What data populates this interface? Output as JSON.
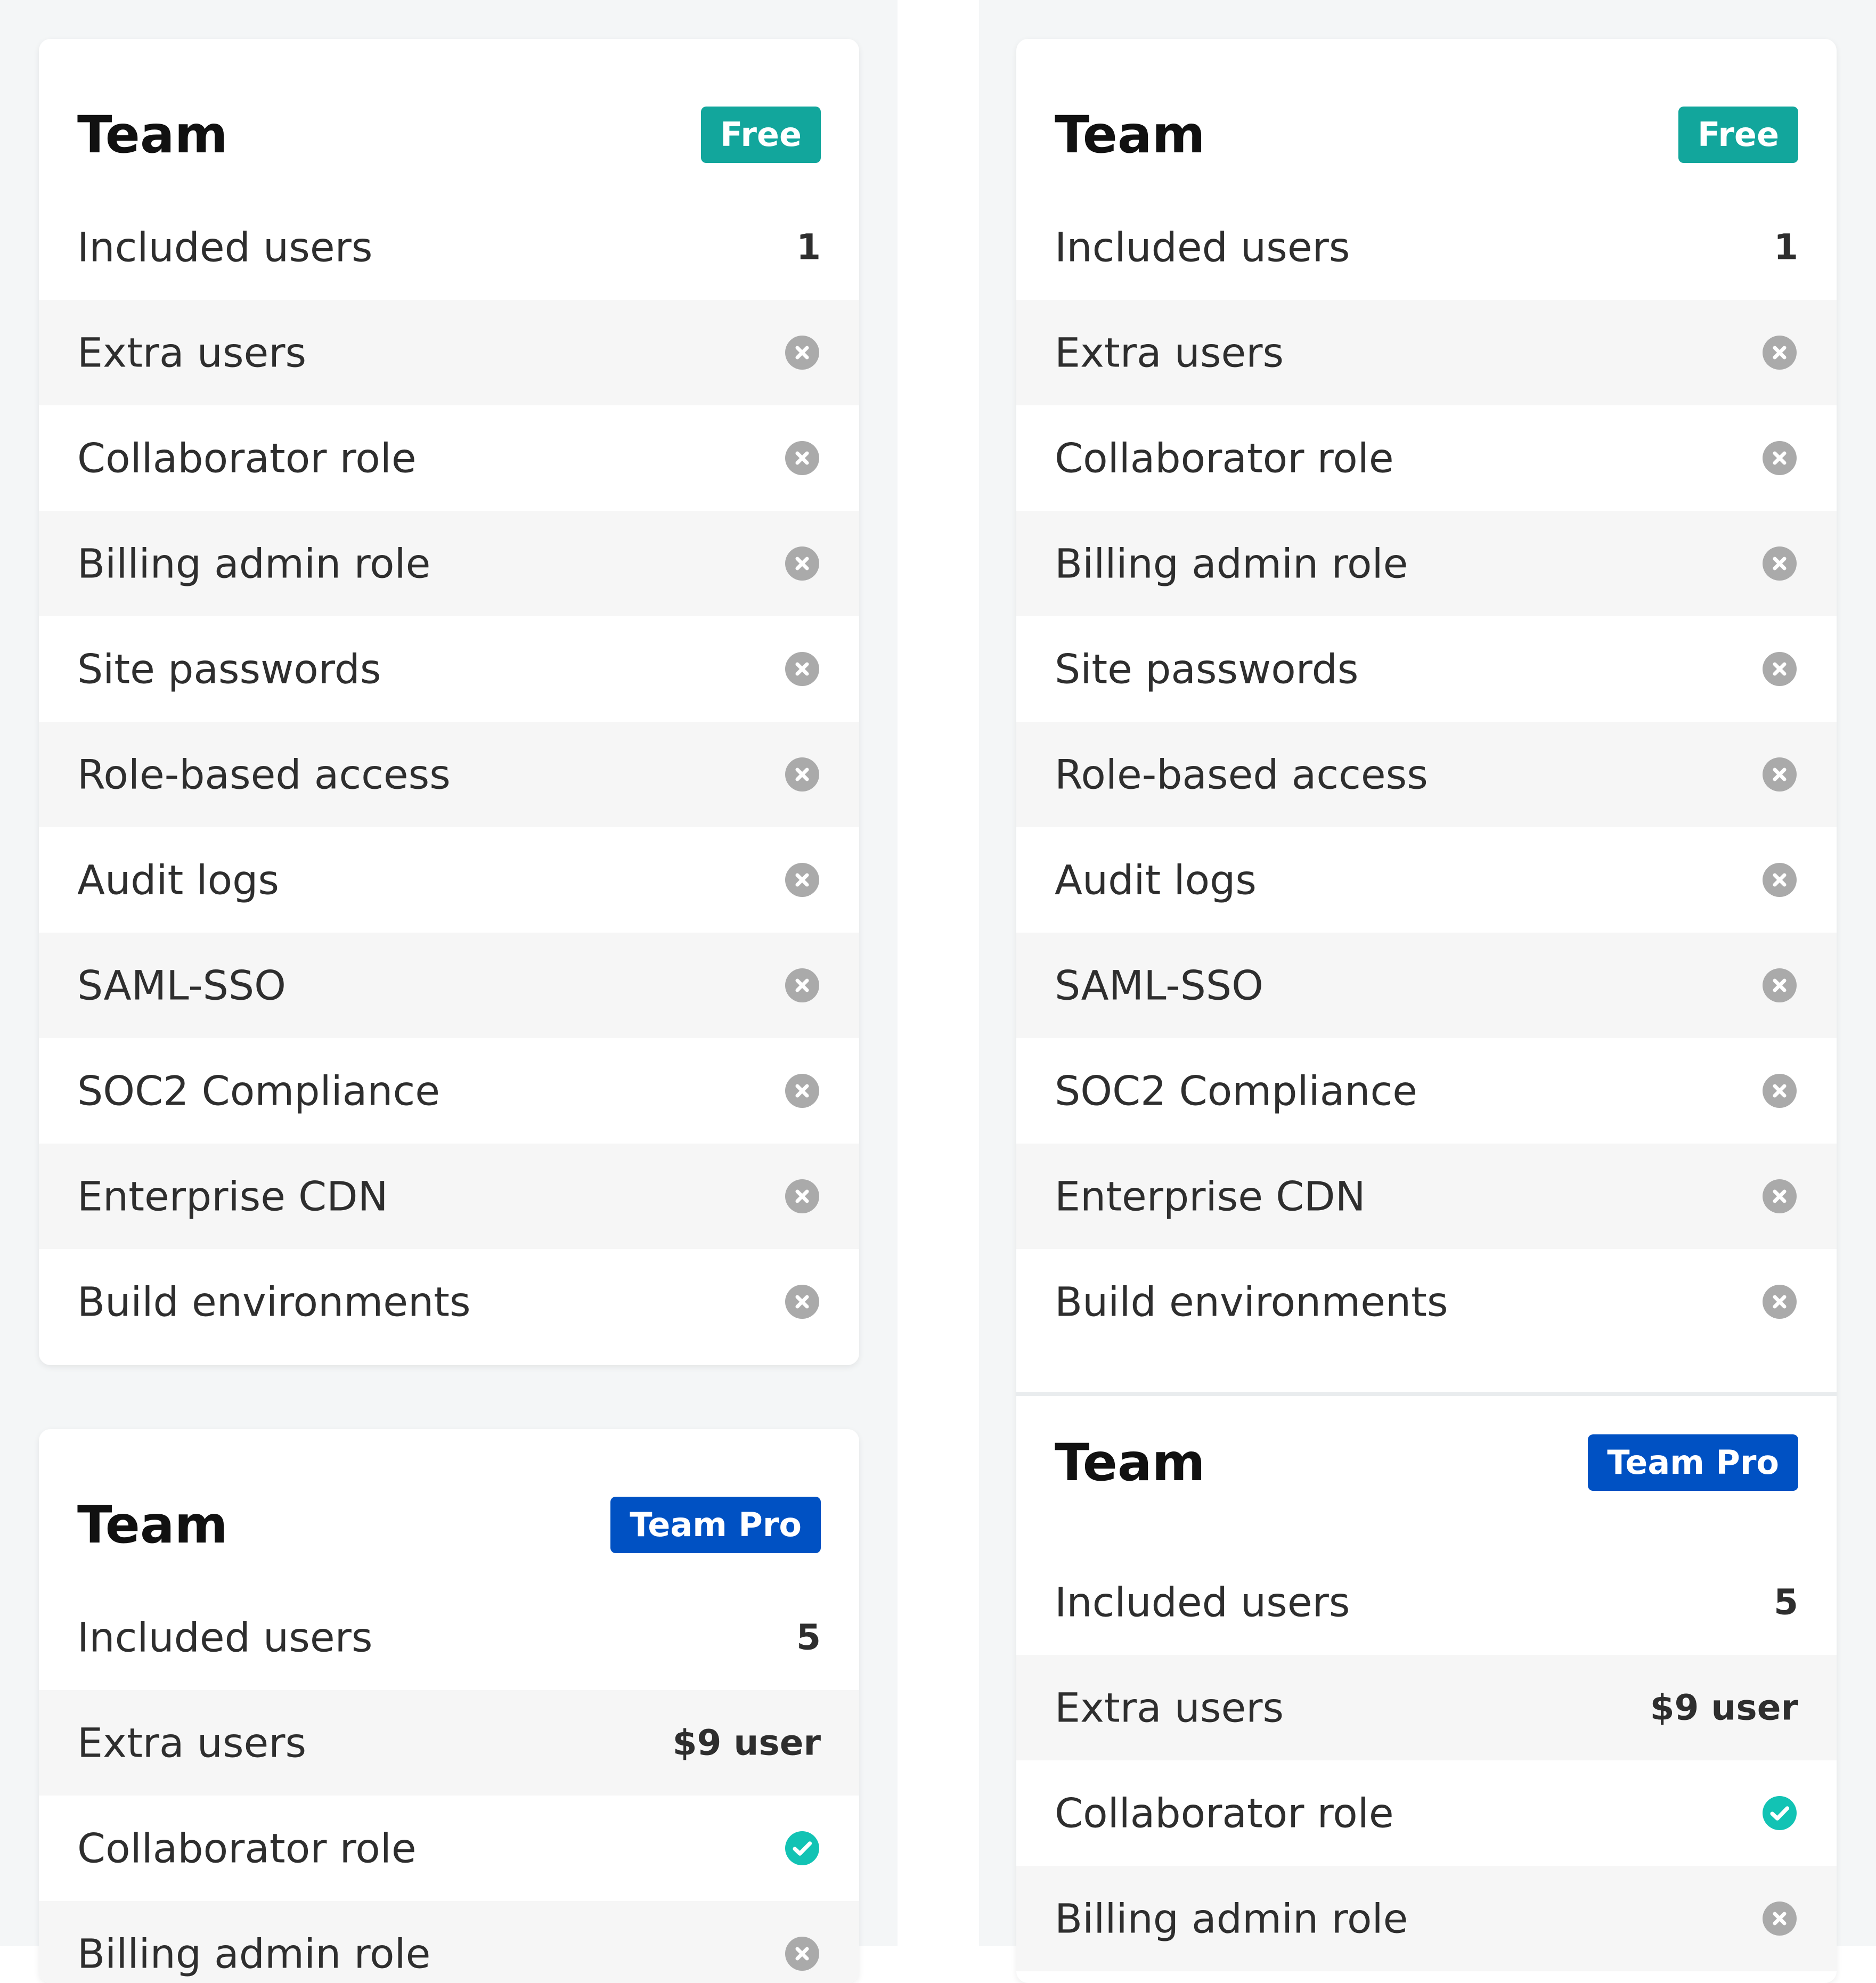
{
  "colors": {
    "page_bg": "#f4f6f7",
    "card_bg": "#ffffff",
    "row_alt_bg": "#f6f6f6",
    "badge_free": "#12a69c",
    "badge_pro": "#0051c3",
    "icon_not_included": "#aaaaaa",
    "icon_included": "#12c3b4"
  },
  "left": {
    "free_card": {
      "title": "Team",
      "badge": "Free",
      "rows": [
        {
          "label": "Included users",
          "value": "1"
        },
        {
          "label": "Extra users",
          "icon": "x-circle-icon"
        },
        {
          "label": "Collaborator role",
          "icon": "x-circle-icon"
        },
        {
          "label": "Billing admin role",
          "icon": "x-circle-icon"
        },
        {
          "label": "Site passwords",
          "icon": "x-circle-icon"
        },
        {
          "label": "Role-based access",
          "icon": "x-circle-icon"
        },
        {
          "label": "Audit logs",
          "icon": "x-circle-icon"
        },
        {
          "label": "SAML-SSO",
          "icon": "x-circle-icon"
        },
        {
          "label": "SOC2 Compliance",
          "icon": "x-circle-icon"
        },
        {
          "label": "Enterprise CDN",
          "icon": "x-circle-icon"
        },
        {
          "label": "Build environments",
          "icon": "x-circle-icon"
        }
      ]
    },
    "pro_card": {
      "title": "Team",
      "badge": "Team Pro",
      "rows": [
        {
          "label": "Included users",
          "value": "5"
        },
        {
          "label": "Extra users",
          "value": "$9 user"
        },
        {
          "label": "Collaborator role",
          "icon": "check-circle-icon"
        },
        {
          "label": "Billing admin role",
          "icon": "x-circle-icon"
        }
      ]
    }
  },
  "right": {
    "free_card": {
      "title": "Team",
      "badge": "Free",
      "rows": [
        {
          "label": "Included users",
          "value": "1"
        },
        {
          "label": "Extra users",
          "icon": "x-circle-icon"
        },
        {
          "label": "Collaborator role",
          "icon": "x-circle-icon"
        },
        {
          "label": "Billing admin role",
          "icon": "x-circle-icon"
        },
        {
          "label": "Site passwords",
          "icon": "x-circle-icon"
        },
        {
          "label": "Role-based access",
          "icon": "x-circle-icon"
        },
        {
          "label": "Audit logs",
          "icon": "x-circle-icon"
        },
        {
          "label": "SAML-SSO",
          "icon": "x-circle-icon"
        },
        {
          "label": "SOC2 Compliance",
          "icon": "x-circle-icon"
        },
        {
          "label": "Enterprise CDN",
          "icon": "x-circle-icon"
        },
        {
          "label": "Build environments",
          "icon": "x-circle-icon"
        }
      ]
    },
    "pro_card": {
      "title": "Team",
      "badge": "Team Pro",
      "rows": [
        {
          "label": "Included users",
          "value": "5"
        },
        {
          "label": "Extra users",
          "value": "$9 user"
        },
        {
          "label": "Collaborator role",
          "icon": "check-circle-icon"
        },
        {
          "label": "Billing admin role",
          "icon": "x-circle-icon"
        }
      ]
    }
  }
}
